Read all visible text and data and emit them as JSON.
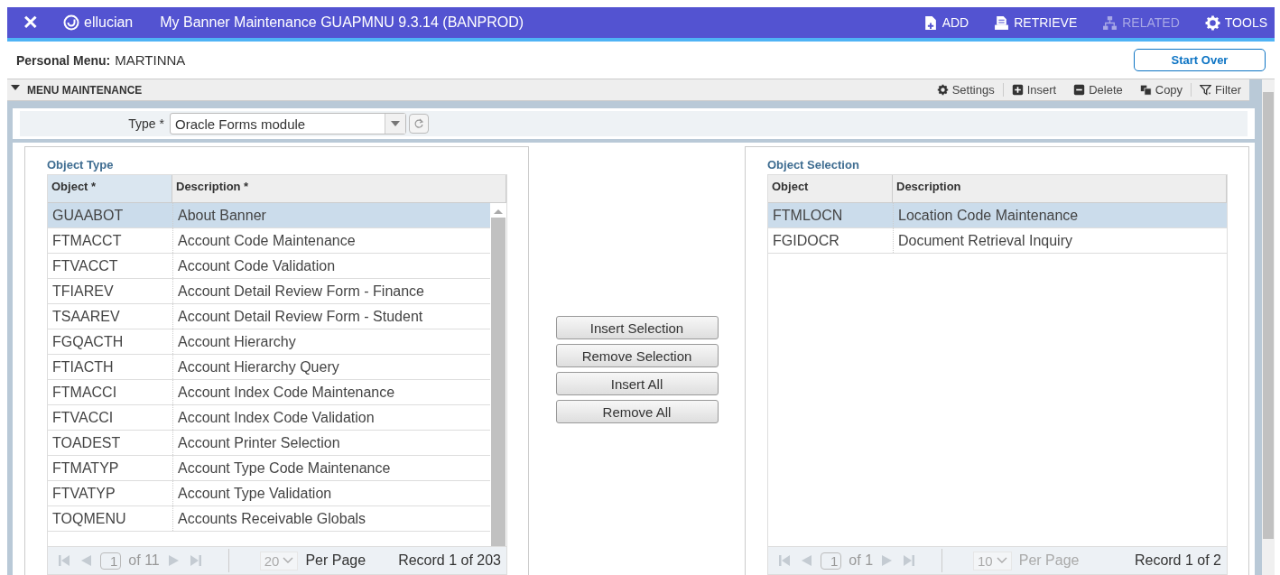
{
  "header": {
    "close": "✕",
    "brand": "ellucian",
    "title": "My Banner Maintenance GUAPMNU 9.3.14 (BANPROD)",
    "actions": [
      {
        "kind": "add",
        "label": "ADD",
        "disabled": false
      },
      {
        "kind": "retrieve",
        "label": "RETRIEVE",
        "disabled": false
      },
      {
        "kind": "related",
        "label": "RELATED",
        "disabled": true
      },
      {
        "kind": "tools",
        "label": "TOOLS",
        "disabled": false
      }
    ]
  },
  "personal_menu": {
    "label": "Personal Menu:",
    "value": "MARTINNA",
    "start_over": "Start Over"
  },
  "section": {
    "title": "MENU MAINTENANCE",
    "expanded": true,
    "tools": [
      {
        "kind": "settings",
        "label": "Settings"
      },
      {
        "kind": "insert",
        "label": "Insert"
      },
      {
        "kind": "delete",
        "label": "Delete"
      },
      {
        "kind": "copy",
        "label": "Copy"
      },
      {
        "kind": "filter",
        "label": "Filter"
      }
    ]
  },
  "type_field": {
    "label": "Type *",
    "value": "Oracle Forms module"
  },
  "object_type": {
    "title": "Object Type",
    "columns": [
      {
        "label": "Object *",
        "active": true
      },
      {
        "label": "Description *",
        "active": false
      }
    ],
    "rows": [
      {
        "object": "GUAABOT",
        "description": "About Banner",
        "selected": true
      },
      {
        "object": "FTMACCT",
        "description": "Account Code Maintenance",
        "selected": false
      },
      {
        "object": "FTVACCT",
        "description": "Account Code Validation",
        "selected": false
      },
      {
        "object": "TFIAREV",
        "description": "Account Detail Review  Form - Finance",
        "selected": false
      },
      {
        "object": "TSAAREV",
        "description": "Account Detail Review Form - Student",
        "selected": false
      },
      {
        "object": "FGQACTH",
        "description": "Account Hierarchy",
        "selected": false
      },
      {
        "object": "FTIACTH",
        "description": "Account Hierarchy Query",
        "selected": false
      },
      {
        "object": "FTMACCI",
        "description": "Account Index Code Maintenance",
        "selected": false
      },
      {
        "object": "FTVACCI",
        "description": "Account Index Code Validation",
        "selected": false
      },
      {
        "object": "TOADEST",
        "description": "Account Printer Selection",
        "selected": false
      },
      {
        "object": "FTMATYP",
        "description": "Account Type Code Maintenance",
        "selected": false
      },
      {
        "object": "FTVATYP",
        "description": "Account Type Validation",
        "selected": false
      },
      {
        "object": "TOQMENU",
        "description": "Accounts Receivable Globals",
        "selected": false
      }
    ],
    "pager": {
      "page": "1",
      "of": "of 11",
      "per_page": "20",
      "per_page_label": "Per Page",
      "per_page_disabled": false,
      "record": "Record 1 of 203"
    }
  },
  "transfer_buttons": [
    "Insert Selection",
    "Remove Selection",
    "Insert All",
    "Remove All"
  ],
  "object_selection": {
    "title": "Object Selection",
    "columns": [
      {
        "label": "Object",
        "active": false
      },
      {
        "label": "Description",
        "active": false
      }
    ],
    "rows": [
      {
        "object": "FTMLOCN",
        "description": "Location Code Maintenance",
        "selected": true
      },
      {
        "object": "FGIDOCR",
        "description": "Document Retrieval Inquiry",
        "selected": false
      }
    ],
    "pager": {
      "page": "1",
      "of": "of 1",
      "per_page": "10",
      "per_page_label": "Per Page",
      "per_page_disabled": true,
      "record": "Record 1 of 2"
    }
  }
}
